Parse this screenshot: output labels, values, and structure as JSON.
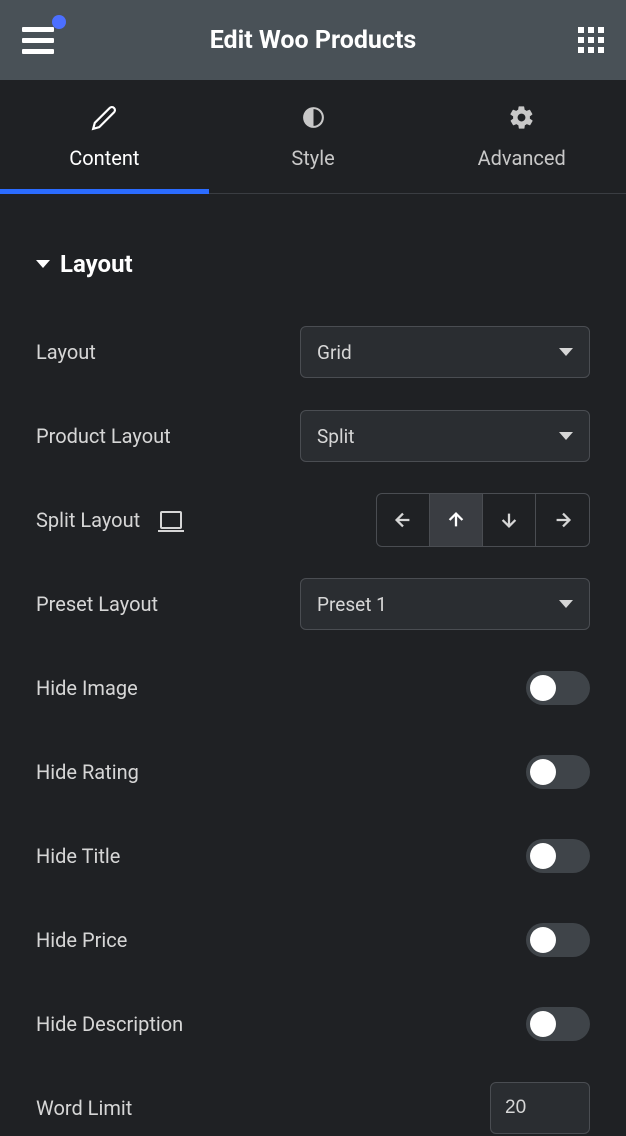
{
  "header": {
    "title": "Edit Woo Products"
  },
  "tabs": [
    {
      "label": "Content",
      "icon": "pencil",
      "active": true
    },
    {
      "label": "Style",
      "icon": "contrast",
      "active": false
    },
    {
      "label": "Advanced",
      "icon": "gear",
      "active": false
    }
  ],
  "section": {
    "title": "Layout"
  },
  "controls": {
    "layout": {
      "label": "Layout",
      "value": "Grid"
    },
    "product_layout": {
      "label": "Product Layout",
      "value": "Split"
    },
    "split_layout": {
      "label": "Split Layout",
      "active_index": 1
    },
    "preset_layout": {
      "label": "Preset Layout",
      "value": "Preset 1"
    },
    "hide_image": {
      "label": "Hide Image",
      "value": false
    },
    "hide_rating": {
      "label": "Hide Rating",
      "value": false
    },
    "hide_title": {
      "label": "Hide Title",
      "value": false
    },
    "hide_price": {
      "label": "Hide Price",
      "value": false
    },
    "hide_description": {
      "label": "Hide Description",
      "value": false
    },
    "word_limit": {
      "label": "Word Limit",
      "value": "20"
    }
  }
}
